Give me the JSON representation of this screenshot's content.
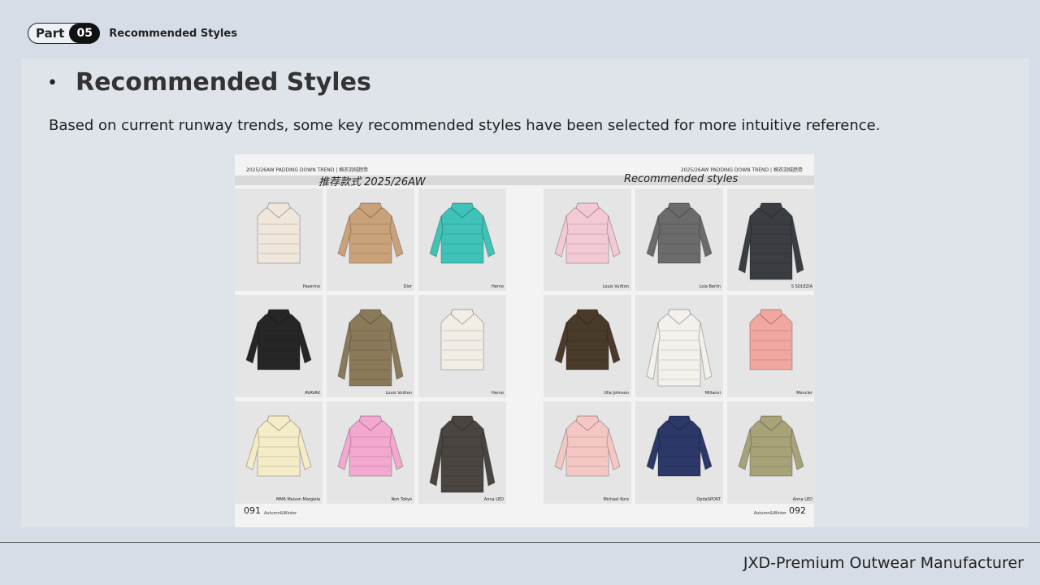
{
  "header": {
    "part_label": "Part",
    "part_number": "05",
    "section_title": "Recommended Styles"
  },
  "panel": {
    "bullet": "•",
    "title": "Recommended Styles",
    "intro": "Based on current runway trends, some key recommended styles have been selected for more intuitive reference."
  },
  "spread": {
    "left_top": "2025/26AW PADDING DOWN TREND | 棉衣羽绒趋势",
    "right_top": "2025/26AW PADDING DOWN TREND | 棉衣羽绒趋势",
    "left_band_title": "推荐款式 2025/26AW",
    "right_band_title": "Recommended styles",
    "left_page": "091",
    "right_page": "092",
    "left_season": "Autumn&Winter",
    "right_season": "Autumn&Winter",
    "items": [
      {
        "brand": "Paserino",
        "garment": "cropped-puffer-vest",
        "color": "#efe6dc"
      },
      {
        "brand": "Dior",
        "garment": "belted-puffer-jacket",
        "color": "#c9a27a"
      },
      {
        "brand": "Herno",
        "garment": "cropped-quilted-jacket",
        "color": "#3fc2b8"
      },
      {
        "brand": "Louis Vuitton",
        "garment": "pink-bomber-jacket",
        "color": "#f3c9d4"
      },
      {
        "brand": "Lola Berlin",
        "garment": "print-quilted-jacket",
        "color": "#6b6b6b"
      },
      {
        "brand": "S SOLEZIA",
        "garment": "long-hooded-puffer",
        "color": "#3a3d42"
      },
      {
        "brand": "AVAVAV",
        "garment": "black-cropped-puffer",
        "color": "#262626"
      },
      {
        "brand": "Louis Vuitton",
        "garment": "olive-belted-coat",
        "color": "#8a7a5a"
      },
      {
        "brand": "Herno",
        "garment": "hooded-shearling-vest",
        "color": "#f2ede5"
      },
      {
        "brand": "Ulla Johnson",
        "garment": "brown-quilted-jacket",
        "color": "#4a3a2a"
      },
      {
        "brand": "Millanni",
        "garment": "white-fur-hood-parka",
        "color": "#f4f1ec"
      },
      {
        "brand": "Moncler",
        "garment": "pink-fur-vest",
        "color": "#f1a7a0"
      },
      {
        "brand": "MM6 Maison Margiela",
        "garment": "cream-wrap-collar-jacket",
        "color": "#f4ecc6"
      },
      {
        "brand": "Non Tokyo",
        "garment": "pink-peplum-jacket",
        "color": "#f4a8cf"
      },
      {
        "brand": "Anna LED",
        "garment": "leather-quilted-coat",
        "color": "#4a4540"
      },
      {
        "brand": "Michael Kors",
        "garment": "pink-puffer-jacket",
        "color": "#f4c7c4"
      },
      {
        "brand": "OpdaSPORT",
        "garment": "navy-quilted-bomber",
        "color": "#2c3868"
      },
      {
        "brand": "Anna LED",
        "garment": "khaki-quilted-jacket",
        "color": "#a8a279"
      }
    ]
  },
  "footer": {
    "text": "JXD-Premium Outwear Manufacturer"
  }
}
